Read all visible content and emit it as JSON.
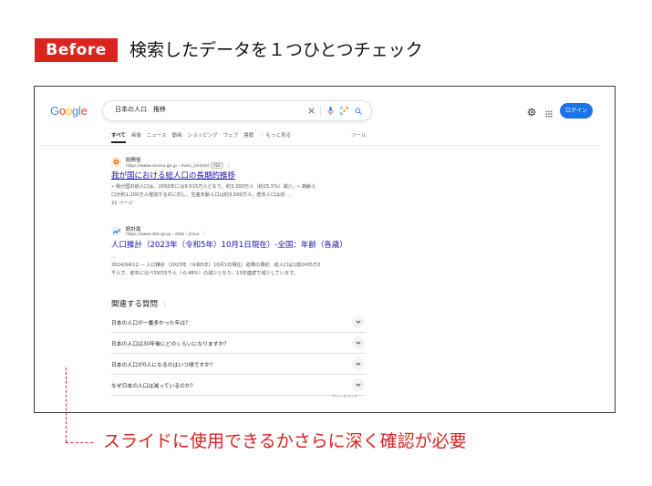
{
  "slide": {
    "badge": "Before",
    "heading": "検索したデータを１つひとつチェック",
    "note": "スライドに使用できるかさらに深く確認が必要"
  },
  "browser": {
    "logo": [
      "G",
      "o",
      "o",
      "g",
      "l",
      "e"
    ],
    "search": {
      "value": "日本の人口　推移"
    },
    "login_label": "ログイン",
    "tabs": [
      "すべて",
      "画像",
      "ニュース",
      "動画",
      "ショッピング",
      "ウェブ",
      "書籍",
      "⋮ もっと見る"
    ],
    "tools_label": "ツール",
    "results": [
      {
        "site_name": "総務省",
        "url": "https://www.soumu.go.jp › main_content",
        "badge": "PDF",
        "title": "我が国における総人口の長期的推移",
        "snippet": [
          "» 我が国の総人口は、2050年には9,515万人となり、約3,300万人（約25.5%）減少。» 高齢人",
          "口が約1,200万人増加するのに対し、生産年齢人口は約3,500万人、若年人口は約 ...",
          "21 ページ"
        ]
      },
      {
        "site_name": "統計局",
        "url": "https://www.stat.go.jp › data › jinsui",
        "title": "人口推計（2023年（令和5年）10月1日現在）-全国：年齢（各歳）",
        "snippet": [
          "...",
          "2024/04/12 — 人口推計（2023年（令和5年）10月1日現在）結果の要約 · 総人口は1億2435万2",
          "千人で、前年に比べ59万5千人（-0.48％）の減少となり、13年連続で減少しています。"
        ]
      }
    ],
    "paa": {
      "title": "関連する質問",
      "questions": [
        "日本の人口が一番多かった年は？",
        "日本の人口は30年後にどのくらいになりますか？",
        "日本の人口が0人になるのはいつ頃ですか？",
        "なぜ日本の人口は減っているのか？"
      ],
      "fragment": "フィードバック"
    }
  }
}
